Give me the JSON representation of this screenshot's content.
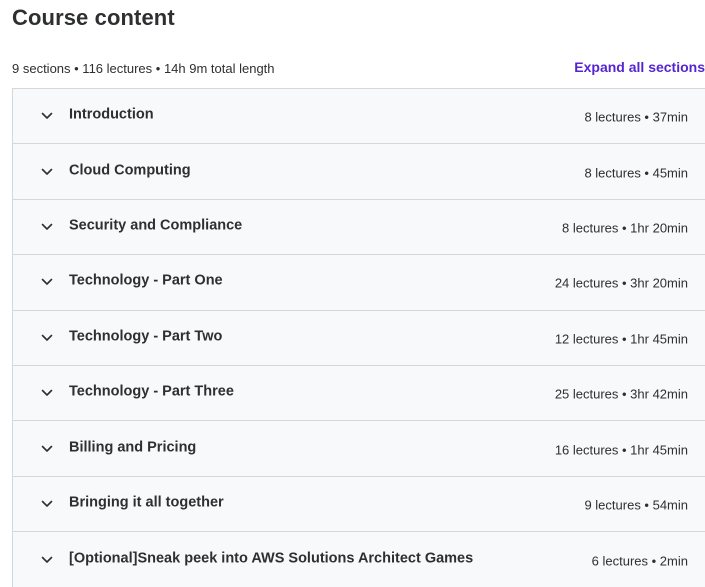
{
  "header": {
    "title": "Course content",
    "summary": "9 sections • 116 lectures • 14h 9m total length",
    "expand_all_label": "Expand all sections"
  },
  "colors": {
    "accent": "#5624d0",
    "row_background": "#f7f9fa",
    "border": "#d1d7dc",
    "text": "#2d2f31"
  },
  "icons": {
    "expand": "chevron-down-icon"
  },
  "sections": [
    {
      "title": "Introduction",
      "meta": "8 lectures • 37min"
    },
    {
      "title": "Cloud Computing",
      "meta": "8 lectures • 45min"
    },
    {
      "title": "Security and Compliance",
      "meta": "8 lectures • 1hr 20min"
    },
    {
      "title": "Technology - Part One",
      "meta": "24 lectures • 3hr 20min"
    },
    {
      "title": "Technology - Part Two",
      "meta": "12 lectures • 1hr 45min"
    },
    {
      "title": "Technology - Part Three",
      "meta": "25 lectures • 3hr 42min"
    },
    {
      "title": "Billing and Pricing",
      "meta": "16 lectures • 1hr 45min"
    },
    {
      "title": "Bringing it all together",
      "meta": "9 lectures • 54min"
    },
    {
      "title": "[Optional]Sneak peek into AWS Solutions Architect Games",
      "meta": "6 lectures • 2min"
    }
  ]
}
